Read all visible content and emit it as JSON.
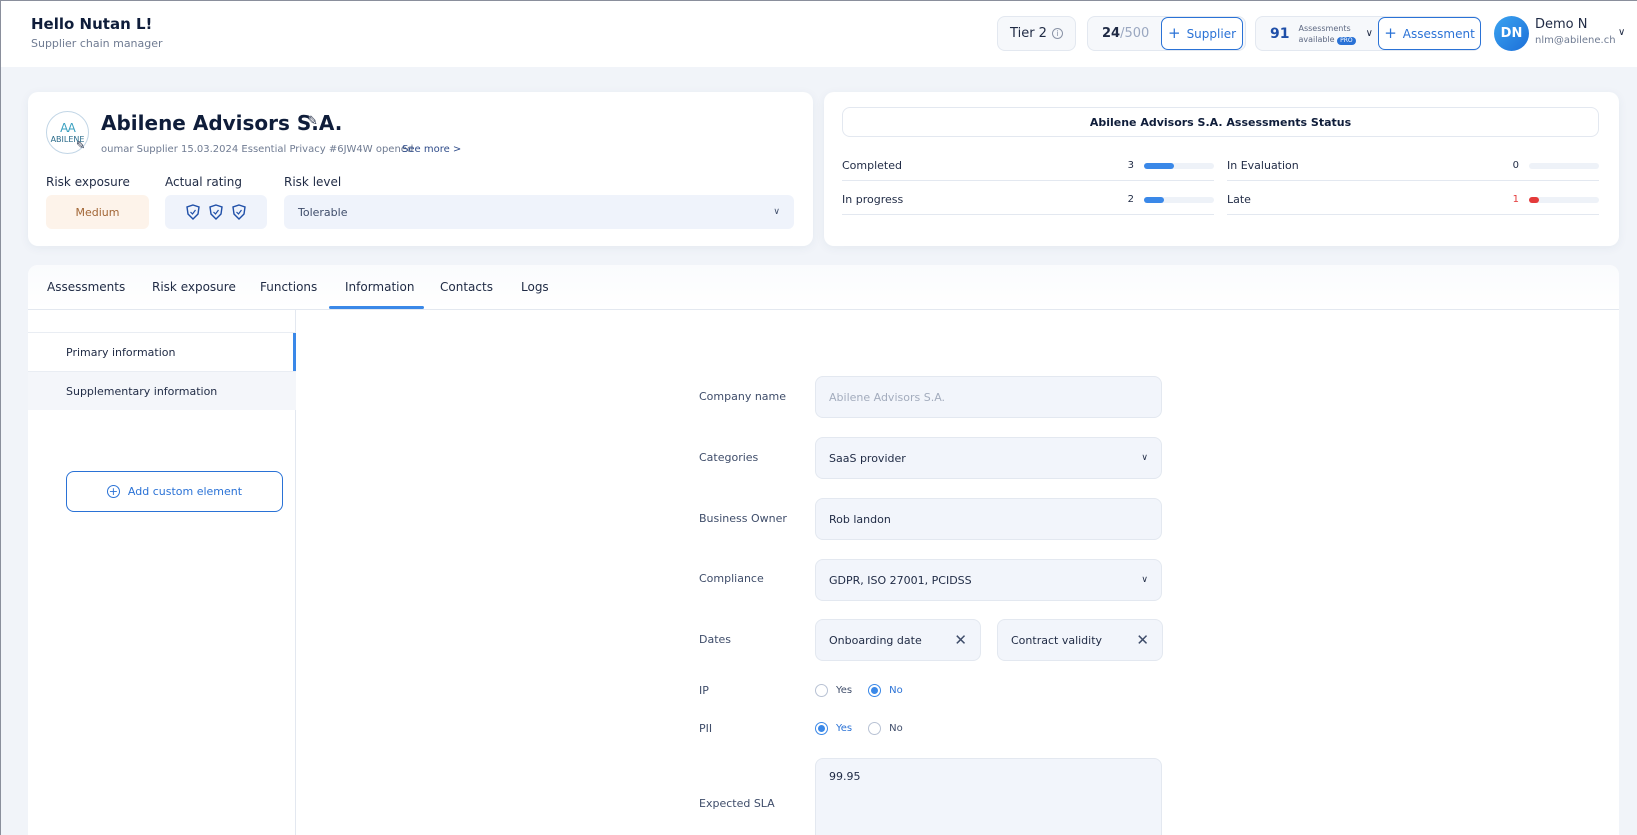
{
  "header": {
    "greeting": "Hello Nutan L!",
    "role": "Supplier chain manager",
    "tier": "Tier 2",
    "supplier_count": "24",
    "supplier_max": "/500",
    "add_supplier_label": "Supplier",
    "assessments_count": "91",
    "assessments_text": "Assessments",
    "assessments_available": "available",
    "pro_badge": "PRO",
    "add_assessment_label": "Assessment",
    "user_initials": "DN",
    "user_name": "Demo N",
    "user_email": "nlm@abilene.ch"
  },
  "supplier": {
    "logo_mark": "AA",
    "logo_text": "ABILENE",
    "name": "Abilene Advisors S.A.",
    "meta": "oumar Supplier 15.03.2024 Essential Privacy #6JW4W opened",
    "see_more": "See more >",
    "risk_exposure_label": "Risk exposure",
    "risk_exposure_value": "Medium",
    "actual_rating_label": "Actual rating",
    "risk_level_label": "Risk level",
    "risk_level_value": "Tolerable"
  },
  "status": {
    "title": "Abilene Advisors S.A. Assessments Status",
    "rows": [
      {
        "name": "Completed",
        "value": "3",
        "fraction": 0.43
      },
      {
        "name": "In Evaluation",
        "value": "0",
        "fraction": 0
      },
      {
        "name": "In progress",
        "value": "2",
        "fraction": 0.29
      },
      {
        "name": "Late",
        "value": "1",
        "fraction": 0.14
      }
    ]
  },
  "tabs": [
    {
      "label": "Assessments"
    },
    {
      "label": "Risk exposure"
    },
    {
      "label": "Functions"
    },
    {
      "label": "Information"
    },
    {
      "label": "Contacts"
    },
    {
      "label": "Logs"
    }
  ],
  "sidebar": {
    "primary": "Primary information",
    "supplementary": "Supplementary information",
    "add_custom": "Add custom element"
  },
  "form": {
    "company_name_label": "Company name",
    "company_name_value": "Abilene Advisors S.A.",
    "categories_label": "Categories",
    "categories_value": "SaaS provider",
    "business_owner_label": "Business Owner",
    "business_owner_value": "Rob landon",
    "compliance_label": "Compliance",
    "compliance_value": "GDPR, ISO 27001, PCIDSS",
    "dates_label": "Dates",
    "onboarding_date": "Onboarding date",
    "contract_validity": "Contract validity",
    "ip_label": "IP",
    "pii_label": "PII",
    "yes": "Yes",
    "no": "No",
    "sla_label": "Expected SLA",
    "sla_value": "99.95"
  },
  "colors": {
    "accent": "#2a72d6",
    "late": "#e43a3a",
    "medium": "#a26636"
  }
}
